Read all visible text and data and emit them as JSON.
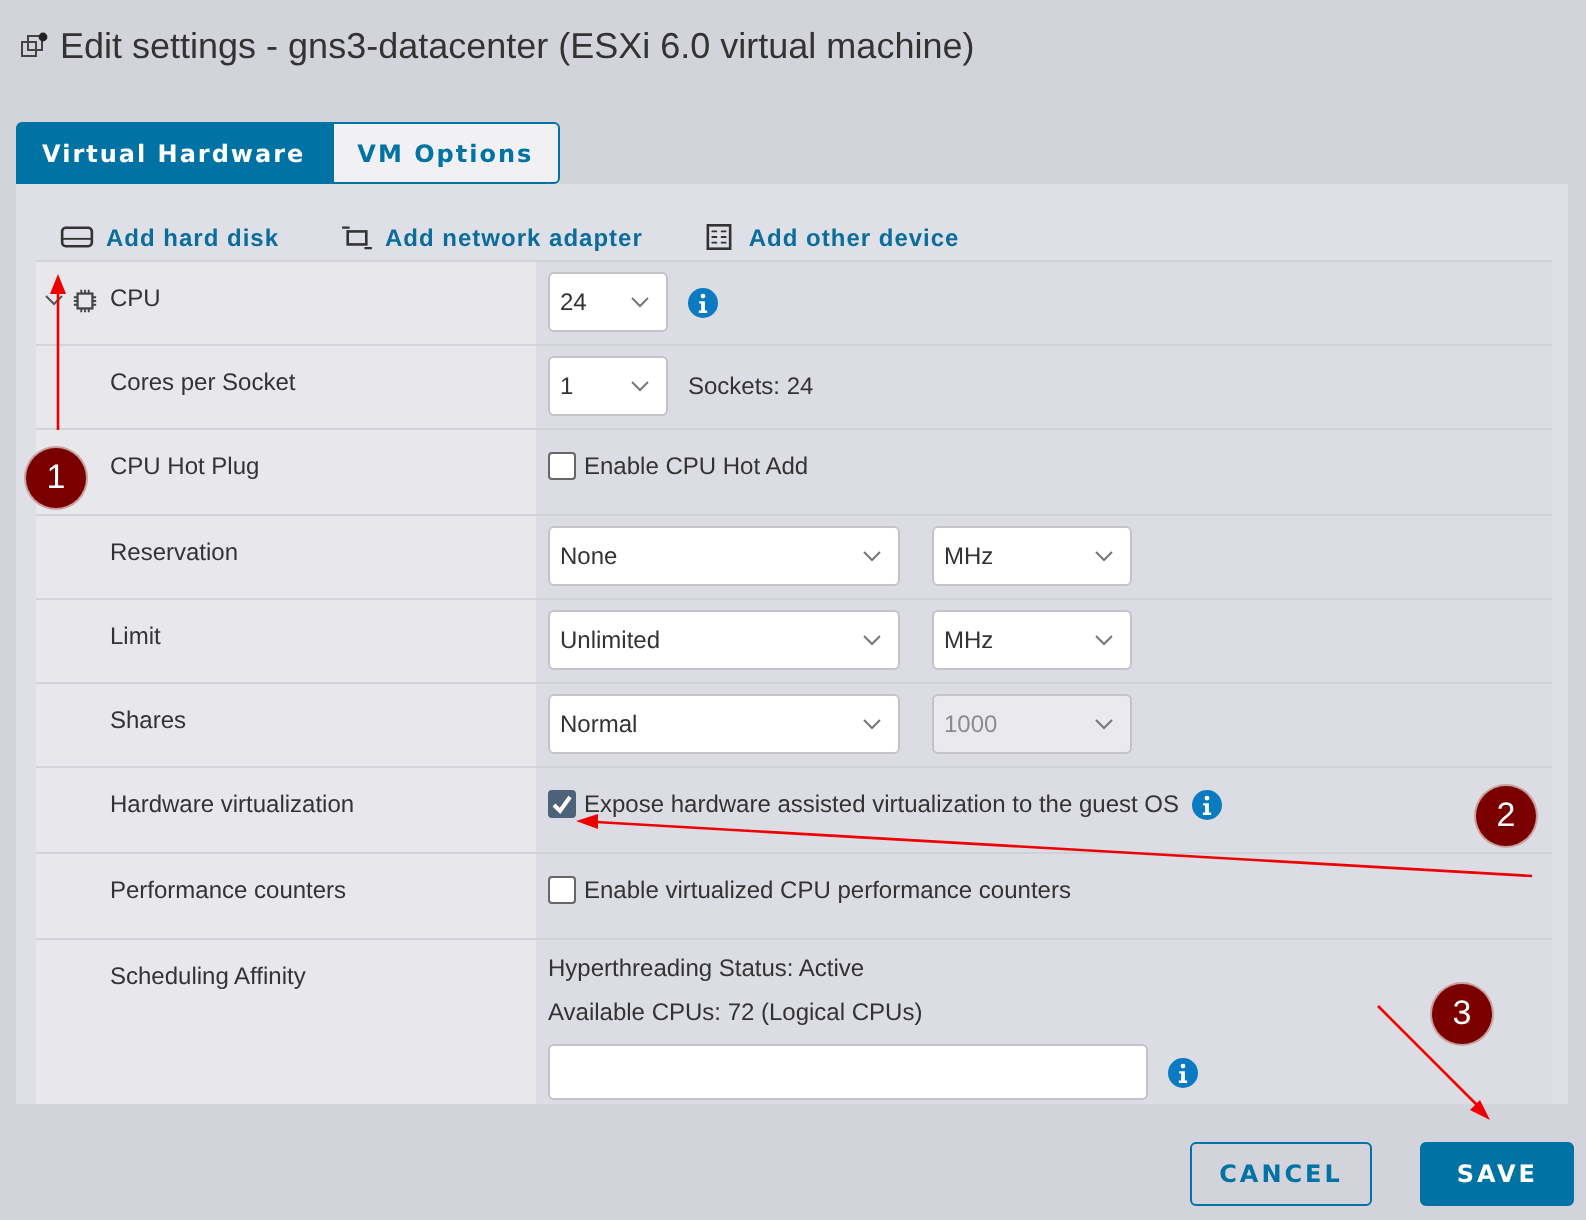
{
  "window": {
    "title": "Edit settings - gns3-datacenter (ESXi 6.0 virtual machine)"
  },
  "tabs": [
    {
      "label": "Virtual Hardware",
      "selected": true
    },
    {
      "label": "VM Options",
      "selected": false
    }
  ],
  "toolbar": [
    {
      "label": "Add hard disk",
      "kind": "disk"
    },
    {
      "label": "Add network adapter",
      "kind": "network"
    },
    {
      "label": "Add other device",
      "kind": "device"
    }
  ],
  "rows": [
    {
      "label": "CPU",
      "kind": "select_info",
      "expanded": true,
      "selects": [
        {
          "value": "24",
          "disabled": false
        }
      ]
    },
    {
      "label": "Cores per Socket",
      "kind": "select_text",
      "selects": [
        {
          "value": "1",
          "disabled": false
        }
      ],
      "text": "Sockets: 24"
    },
    {
      "label": "CPU Hot Plug",
      "kind": "checkbox",
      "checkbox": {
        "label": "Enable CPU Hot Add",
        "checked": false
      }
    },
    {
      "label": "Reservation",
      "kind": "select_pair",
      "selects": [
        {
          "value": "None",
          "disabled": false
        },
        {
          "value": "MHz",
          "disabled": false
        }
      ]
    },
    {
      "label": "Limit",
      "kind": "select_pair",
      "selects": [
        {
          "value": "Unlimited",
          "disabled": false
        },
        {
          "value": "MHz",
          "disabled": false
        }
      ]
    },
    {
      "label": "Shares",
      "kind": "select_pair",
      "selects": [
        {
          "value": "Normal",
          "disabled": false
        },
        {
          "value": "1000",
          "disabled": true
        }
      ]
    },
    {
      "label": "Hardware virtualization",
      "kind": "checkbox",
      "info": true,
      "checkbox": {
        "label": "Expose hardware assisted virtualization to the guest OS",
        "checked": true
      }
    },
    {
      "label": "Performance counters",
      "kind": "checkbox",
      "checkbox": {
        "label": "Enable virtualized CPU performance counters",
        "checked": false
      }
    },
    {
      "label": "Scheduling Affinity",
      "kind": "affinity",
      "lines": [
        "Hyperthreading Status: Active",
        "Available CPUs: 72 (Logical CPUs)"
      ]
    }
  ],
  "annotations": [
    {
      "label": "1"
    },
    {
      "label": "2"
    },
    {
      "label": "3"
    }
  ],
  "buttons": [
    {
      "label": "CANCEL",
      "kind": "secondary"
    },
    {
      "label": "SAVE",
      "kind": "primary"
    }
  ]
}
